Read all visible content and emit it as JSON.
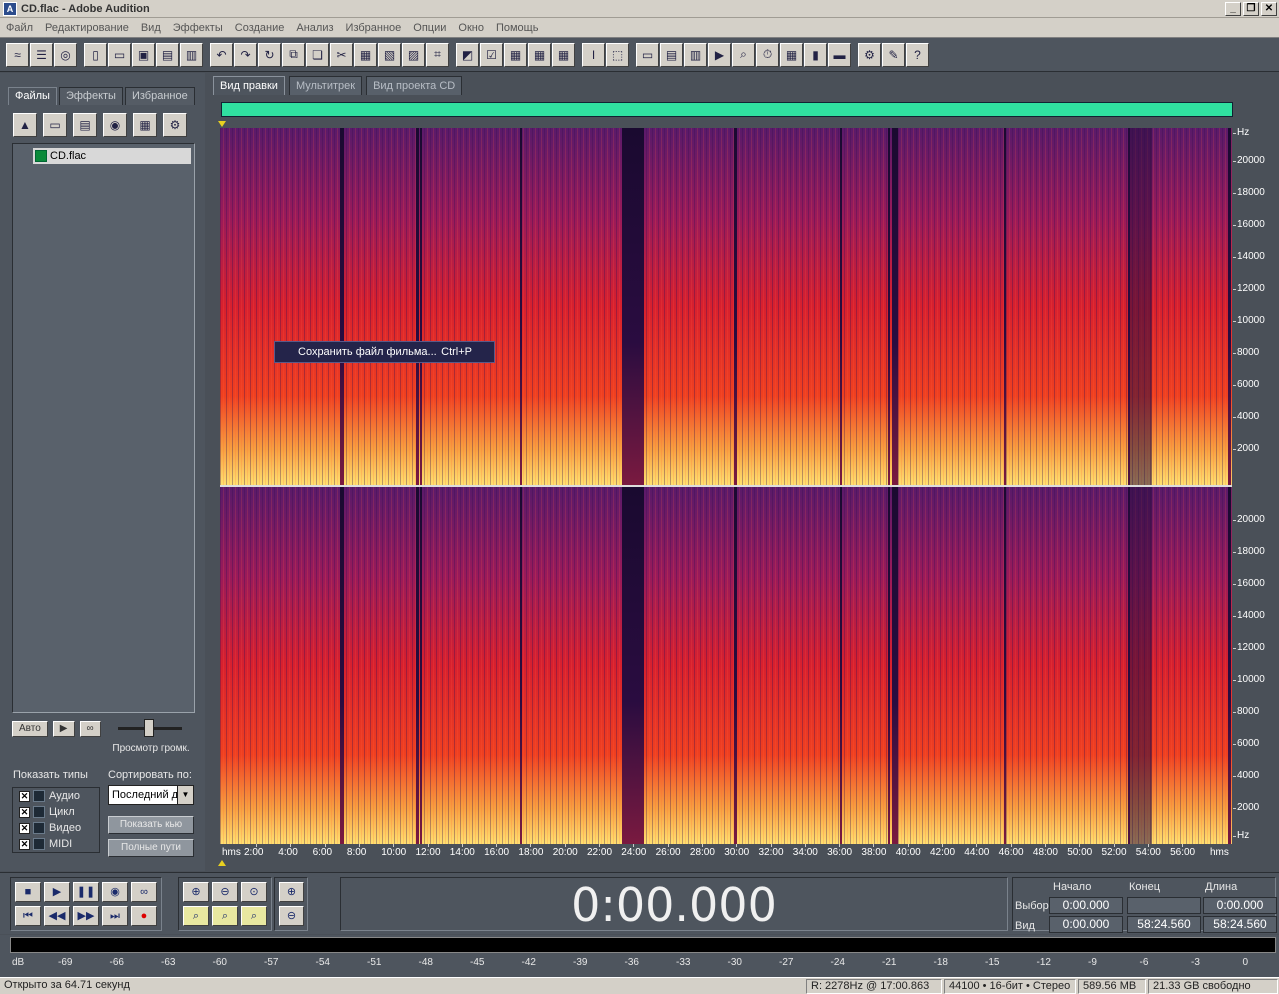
{
  "window": {
    "title": "CD.flac - Adobe Audition",
    "app_icon": "au-icon"
  },
  "menu": [
    "Файл",
    "Редактирование",
    "Вид",
    "Эффекты",
    "Создание",
    "Анализ",
    "Избранное",
    "Опции",
    "Окно",
    "Помощь"
  ],
  "left_panel": {
    "tabs": [
      "Файлы",
      "Эффекты",
      "Избранное"
    ],
    "active_tab": 0,
    "files": [
      "CD.flac"
    ],
    "auto_label": "Авто",
    "preview_label": "Просмотр громк.",
    "show_types_label": "Показать типы",
    "sort_by_label": "Сортировать по:",
    "types": [
      "Аудио",
      "Цикл",
      "Видео",
      "MIDI"
    ],
    "sort_value": "Последний до",
    "show_cue_label": "Показать кью",
    "full_paths_label": "Полные пути"
  },
  "view_tabs": [
    "Вид правки",
    "Мультитрек",
    "Вид проекта CD"
  ],
  "context_menu": {
    "label": "Сохранить файл фильма...",
    "shortcut": "Ctrl+P"
  },
  "hz_labels_top": [
    "Hz",
    "20000",
    "18000",
    "16000",
    "14000",
    "12000",
    "10000",
    "8000",
    "6000",
    "4000",
    "2000"
  ],
  "hz_labels_bottom": [
    "20000",
    "18000",
    "16000",
    "14000",
    "12000",
    "10000",
    "8000",
    "6000",
    "4000",
    "2000",
    "Hz"
  ],
  "time_labels": [
    "hms",
    "2:00",
    "4:00",
    "6:00",
    "8:00",
    "10:00",
    "12:00",
    "14:00",
    "16:00",
    "18:00",
    "20:00",
    "22:00",
    "24:00",
    "26:00",
    "28:00",
    "30:00",
    "32:00",
    "34:00",
    "36:00",
    "38:00",
    "40:00",
    "42:00",
    "44:00",
    "46:00",
    "48:00",
    "50:00",
    "52:00",
    "54:00",
    "56:00",
    "hms"
  ],
  "time_display": "0:00.000",
  "selection": {
    "hdr_start": "Начало",
    "hdr_end": "Конец",
    "hdr_length": "Длина",
    "row_sel": "Выбор",
    "row_view": "Вид",
    "sel_start": "0:00.000",
    "sel_end": "",
    "sel_length": "0:00.000",
    "view_start": "0:00.000",
    "view_end": "58:24.560",
    "view_length": "58:24.560"
  },
  "meter_labels": [
    "dB",
    "-69",
    "-66",
    "-63",
    "-60",
    "-57",
    "-54",
    "-51",
    "-48",
    "-45",
    "-42",
    "-39",
    "-36",
    "-33",
    "-30",
    "-27",
    "-24",
    "-21",
    "-18",
    "-15",
    "-12",
    "-9",
    "-6",
    "-3",
    "0"
  ],
  "status": {
    "opened": "Открыто за 64.71 секунд",
    "cursor": "R: 2278Hz @  17:00.863",
    "format": "44100 • 16-бит • Стерео",
    "size": "589.56 MB",
    "free": "21.33 GB свободно"
  },
  "colors": {
    "overview": "#30e0a0",
    "marker": "#e8d020",
    "spectro_hot": "#ffe070",
    "spectro_mid": "#e0202a",
    "spectro_cool": "#3a1050"
  }
}
